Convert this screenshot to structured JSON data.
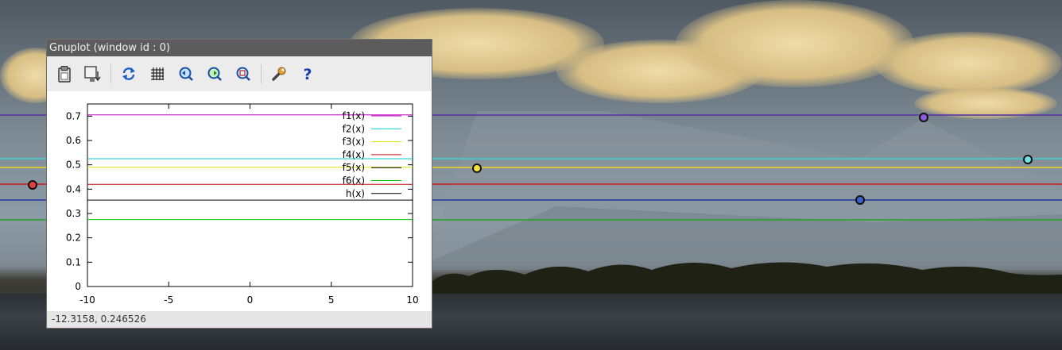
{
  "window": {
    "title": "Gnuplot (window id : 0)",
    "status": "-12.3158,  0.246526"
  },
  "toolbar": {
    "buttons": [
      {
        "icon": "clipboard-icon"
      },
      {
        "icon": "export-icon"
      },
      {
        "icon": "replot-icon"
      },
      {
        "icon": "grid-icon"
      },
      {
        "icon": "zoom-previous-icon"
      },
      {
        "icon": "zoom-next-icon"
      },
      {
        "icon": "autoscale-icon"
      },
      {
        "icon": "settings-icon"
      },
      {
        "icon": "help-icon"
      }
    ]
  },
  "chart_data": {
    "type": "line",
    "xlim": [
      -10,
      10
    ],
    "ylim": [
      0,
      0.75
    ],
    "xticks": [
      "-10",
      "-5",
      "0",
      "5",
      "10"
    ],
    "yticks": [
      "0",
      "0.1",
      "0.2",
      "0.3",
      "0.4",
      "0.5",
      "0.6",
      "0.7"
    ],
    "legend_position": "top-right",
    "series": [
      {
        "name": "f1(x)",
        "value": 0.705,
        "color": "#c000c0"
      },
      {
        "name": "f2(x)",
        "value": 0.525,
        "color": "#00d0d0"
      },
      {
        "name": "f3(x)",
        "value": 0.49,
        "color": "#e0e000"
      },
      {
        "name": "f4(x)",
        "value": 0.42,
        "color": "#c01010"
      },
      {
        "name": "f5(x)",
        "value": 0.355,
        "color": "#000000"
      },
      {
        "name": "f6(x)",
        "value": 0.275,
        "color": "#00c000"
      },
      {
        "name": "h(x)",
        "value": null,
        "color": "#000000"
      }
    ]
  },
  "background_lines": [
    {
      "color": "#5b3aa8",
      "value": 0.705
    },
    {
      "color": "#45c8d0",
      "value": 0.525
    },
    {
      "color": "#e0d030",
      "value": 0.49
    },
    {
      "color": "#c02a2a",
      "value": 0.42
    },
    {
      "color": "#2b3fa0",
      "value": 0.355
    },
    {
      "color": "#30a030",
      "value": 0.275
    }
  ]
}
